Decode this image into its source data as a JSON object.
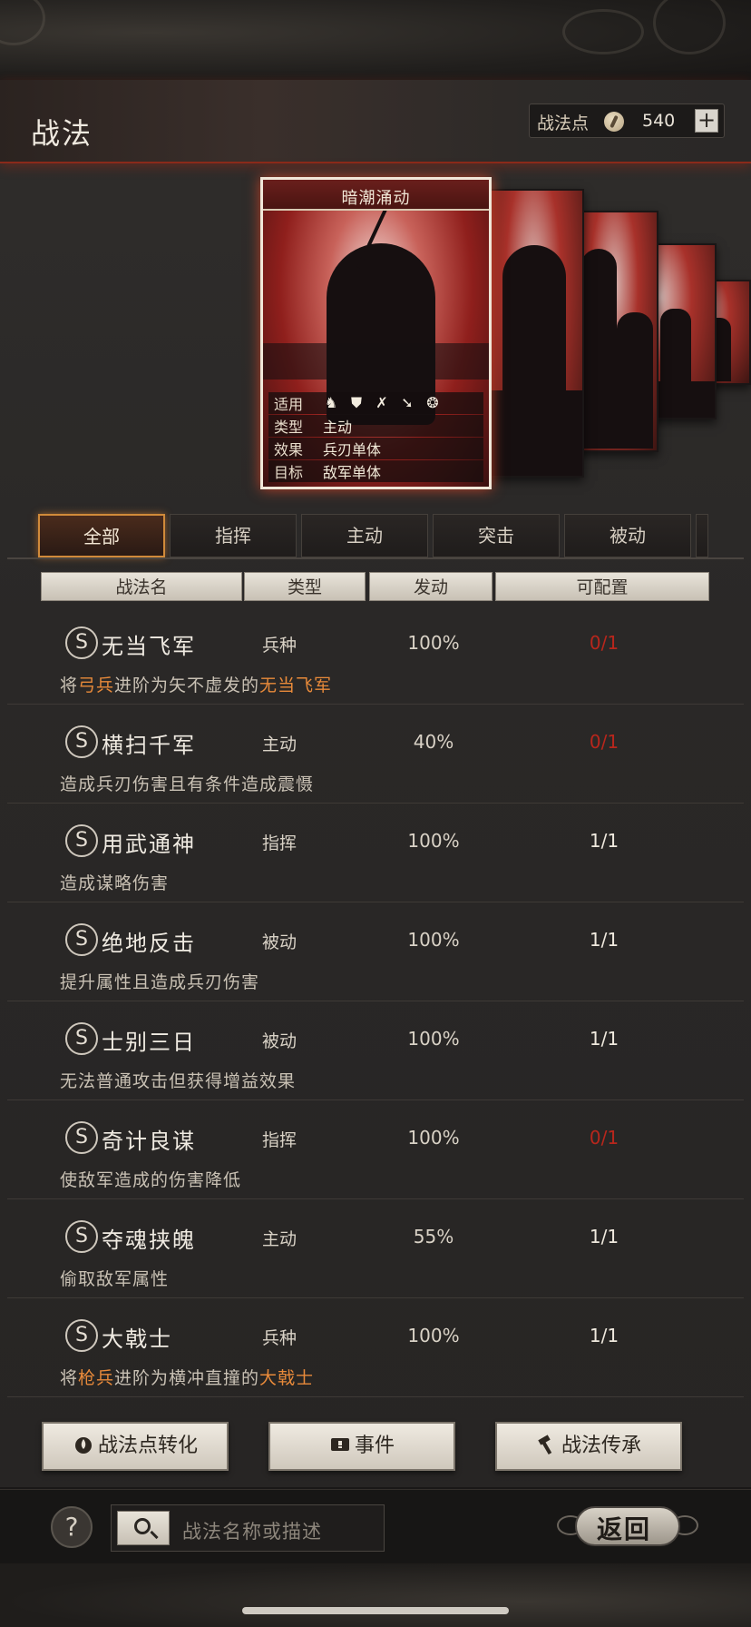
{
  "header": {
    "title": "战法",
    "points_label": "战法点",
    "points_value": "540",
    "plus_label": "+"
  },
  "card": {
    "name": "暗潮涌动",
    "rows": [
      {
        "key": "适用",
        "troops": [
          "cavalry-icon",
          "shield-icon",
          "bow-icon",
          "spear-icon",
          "wheel-icon"
        ]
      },
      {
        "key": "类型",
        "value": "主动"
      },
      {
        "key": "效果",
        "value": "兵刃单体"
      },
      {
        "key": "目标",
        "value": "敌军单体"
      }
    ]
  },
  "tabs": [
    {
      "label": "全部",
      "active": true
    },
    {
      "label": "指挥",
      "active": false
    },
    {
      "label": "主动",
      "active": false
    },
    {
      "label": "突击",
      "active": false
    },
    {
      "label": "被动",
      "active": false
    }
  ],
  "columns": {
    "name": "战法名",
    "type": "类型",
    "rate": "发动",
    "count": "可配置"
  },
  "skills": [
    {
      "grade": "S",
      "name": "无当飞军",
      "type": "兵种",
      "rate": "100%",
      "count": "0/1",
      "count_red": true,
      "desc": [
        {
          "t": "将"
        },
        {
          "t": "弓兵",
          "hl": true
        },
        {
          "t": "进阶为矢不虚发的"
        },
        {
          "t": "无当飞军",
          "hl": true
        }
      ]
    },
    {
      "grade": "S",
      "name": "横扫千军",
      "type": "主动",
      "rate": "40%",
      "count": "0/1",
      "count_red": true,
      "desc": [
        {
          "t": "造成兵刃伤害且有条件造成震慑"
        }
      ]
    },
    {
      "grade": "S",
      "name": "用武通神",
      "type": "指挥",
      "rate": "100%",
      "count": "1/1",
      "count_red": false,
      "desc": [
        {
          "t": "造成谋略伤害"
        }
      ]
    },
    {
      "grade": "S",
      "name": "绝地反击",
      "type": "被动",
      "rate": "100%",
      "count": "1/1",
      "count_red": false,
      "desc": [
        {
          "t": "提升属性且造成兵刃伤害"
        }
      ]
    },
    {
      "grade": "S",
      "name": "士别三日",
      "type": "被动",
      "rate": "100%",
      "count": "1/1",
      "count_red": false,
      "desc": [
        {
          "t": "无法普通攻击但获得增益效果"
        }
      ]
    },
    {
      "grade": "S",
      "name": "奇计良谋",
      "type": "指挥",
      "rate": "100%",
      "count": "0/1",
      "count_red": true,
      "desc": [
        {
          "t": "使敌军造成的伤害降低"
        }
      ]
    },
    {
      "grade": "S",
      "name": "夺魂挟魄",
      "type": "主动",
      "rate": "55%",
      "count": "1/1",
      "count_red": false,
      "desc": [
        {
          "t": "偷取敌军属性"
        }
      ]
    },
    {
      "grade": "S",
      "name": "大戟士",
      "type": "兵种",
      "rate": "100%",
      "count": "1/1",
      "count_red": false,
      "desc": [
        {
          "t": "将"
        },
        {
          "t": "枪兵",
          "hl": true
        },
        {
          "t": "进阶为横冲直撞的"
        },
        {
          "t": "大戟士",
          "hl": true
        }
      ]
    }
  ],
  "buttons": {
    "convert": "战法点转化",
    "events": "事件",
    "inherit": "战法传承"
  },
  "footer": {
    "help": "?",
    "search_placeholder": "战法名称或描述",
    "back": "返回"
  },
  "colors": {
    "highlight": "#e88a3a",
    "count_red": "#b8261c",
    "tab_active_border": "#d08a3a"
  }
}
